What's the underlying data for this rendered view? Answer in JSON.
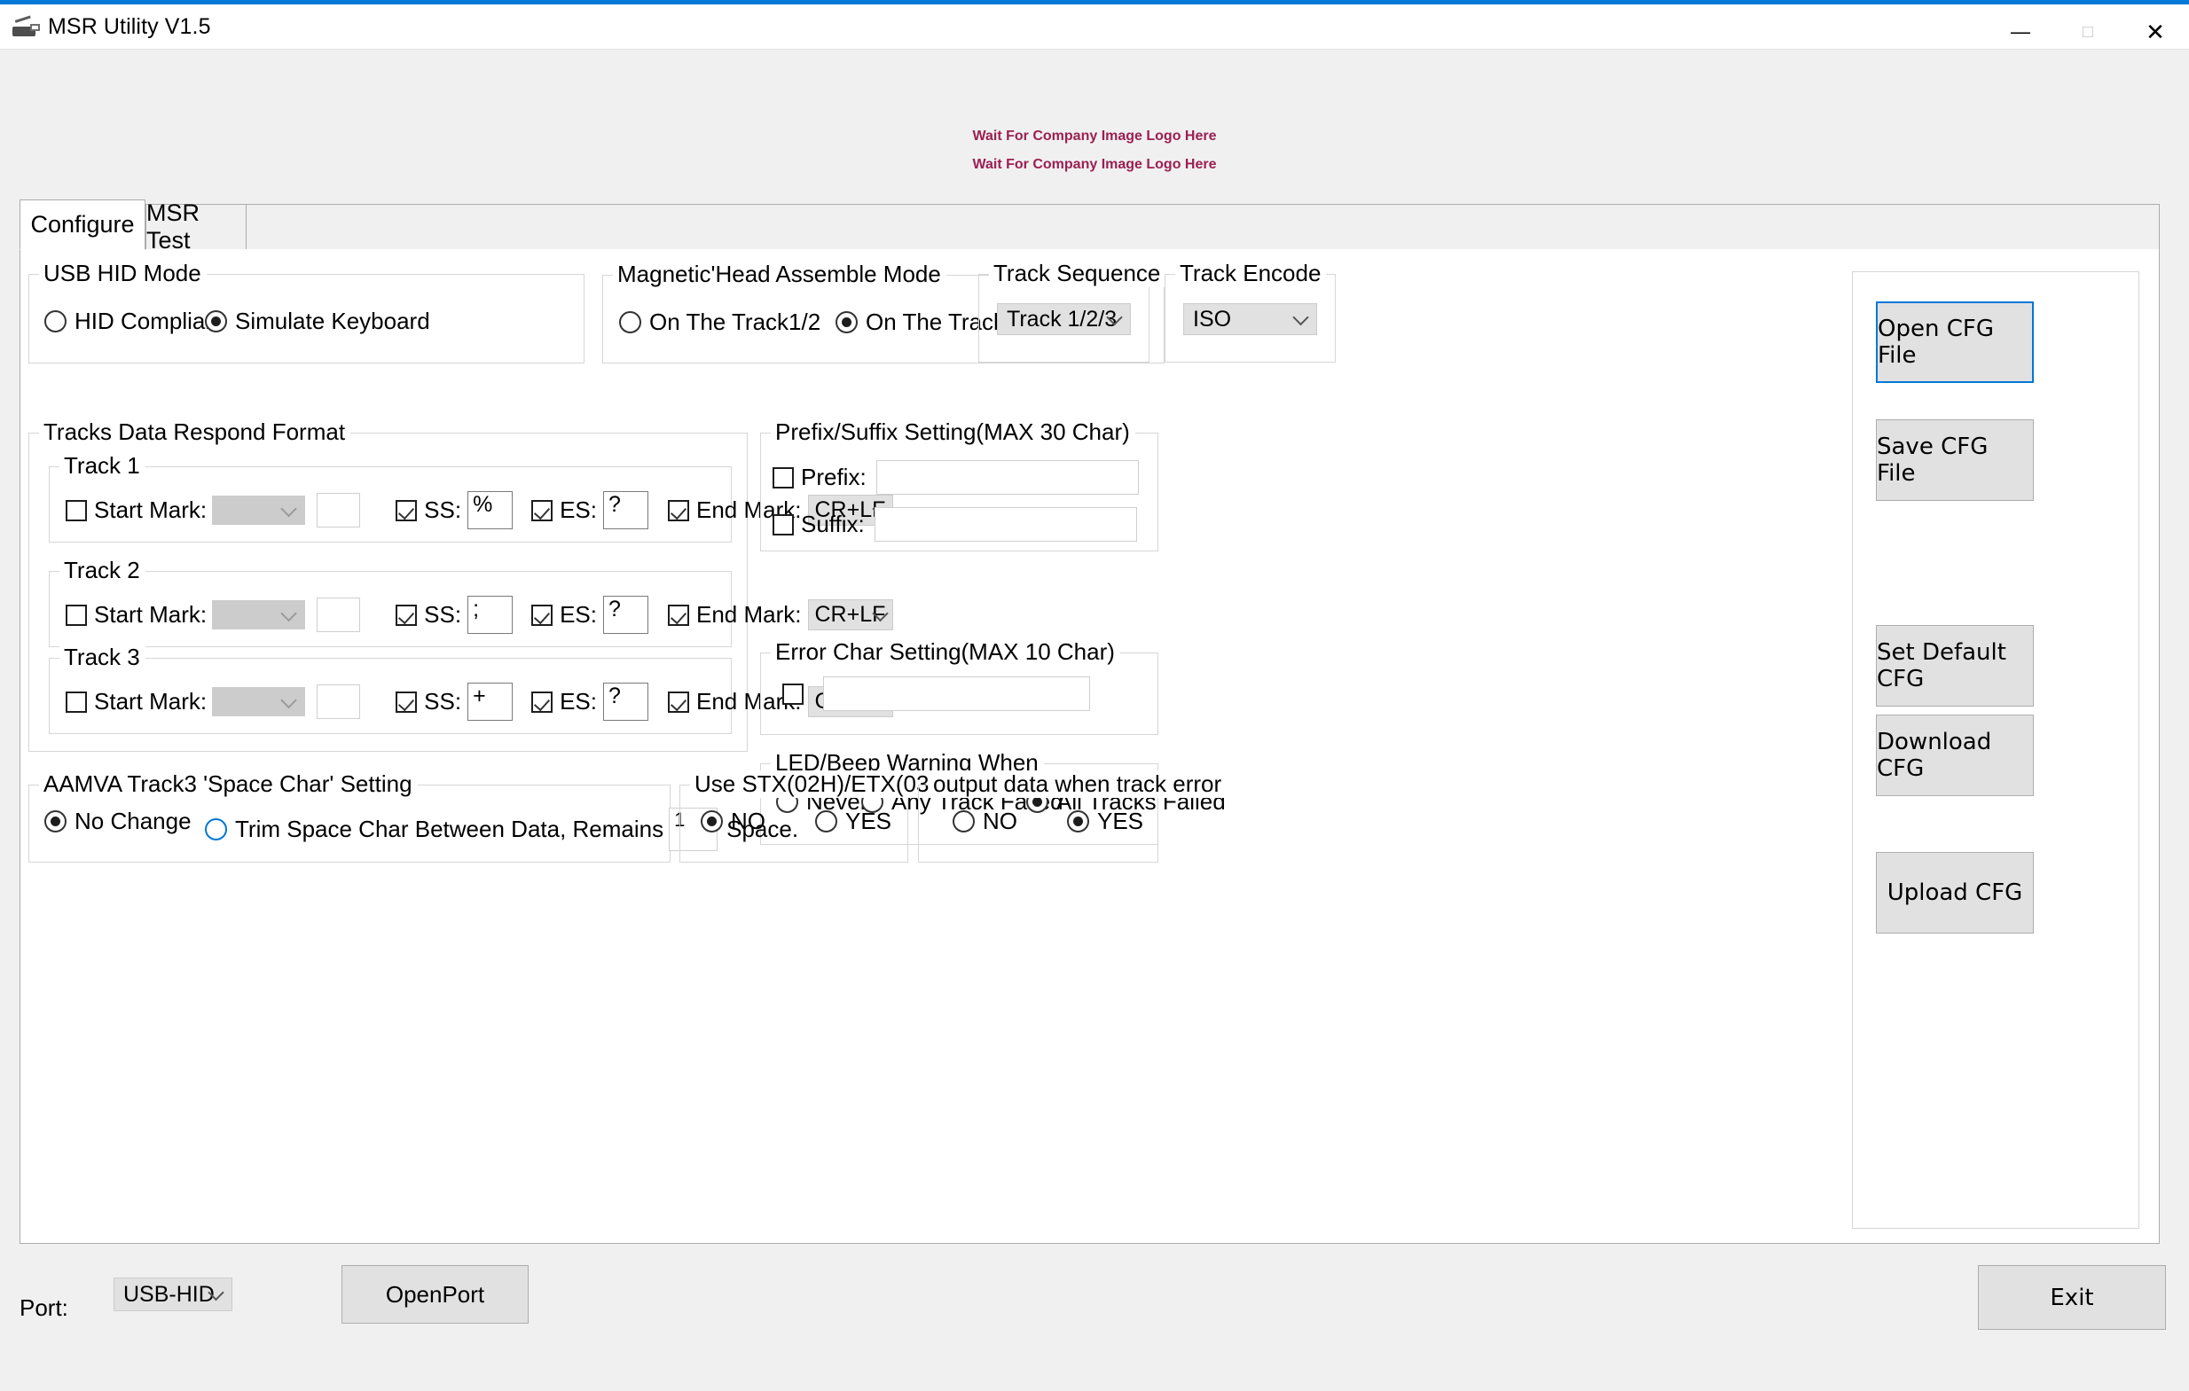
{
  "window": {
    "title": "MSR Utility V1.5",
    "icon": "magnetic-card-reader-icon",
    "minimize": "—",
    "maximize": "□",
    "close": "✕"
  },
  "logo": {
    "line1": "Wait For Company Image Logo Here",
    "line2": "Wait For Company Image Logo Here",
    "color": "#9c1f52"
  },
  "tabs": [
    {
      "label": "Configure",
      "active": true
    },
    {
      "label": "MSR Test",
      "active": false
    }
  ],
  "usb_hid_mode": {
    "title": "USB HID Mode",
    "options": [
      {
        "label": "HID Compliant",
        "selected": false
      },
      {
        "label": "Simulate Keyboard",
        "selected": true
      }
    ]
  },
  "magnetic_head": {
    "title": "Magnetic'Head Assemble Mode",
    "options": [
      {
        "label": "On The Track1/2",
        "selected": false
      },
      {
        "label": "On The Track2/3",
        "selected": true
      }
    ]
  },
  "track_sequence": {
    "title": "Track Sequence",
    "value": "Track 1/2/3"
  },
  "track_encode": {
    "title": "Track Encode",
    "value": "ISO"
  },
  "tracks_format": {
    "title": "Tracks Data Respond Format",
    "labels": {
      "start_mark": "Start Mark:",
      "ss": "SS:",
      "es": "ES:",
      "end_mark": "End Mark:"
    },
    "tracks": [
      {
        "title": "Track 1",
        "start_mark_checked": false,
        "start_mark_value": "",
        "start_mark_extra": "",
        "ss_checked": true,
        "ss_value": "%",
        "es_checked": true,
        "es_value": "?",
        "end_mark_checked": true,
        "end_mark_value": "CR+LF"
      },
      {
        "title": "Track 2",
        "start_mark_checked": false,
        "start_mark_value": "",
        "start_mark_extra": "",
        "ss_checked": true,
        "ss_value": ";",
        "es_checked": true,
        "es_value": "?",
        "end_mark_checked": true,
        "end_mark_value": "CR+LF"
      },
      {
        "title": "Track 3",
        "start_mark_checked": false,
        "start_mark_value": "",
        "start_mark_extra": "",
        "ss_checked": true,
        "ss_value": "+",
        "es_checked": true,
        "es_value": "?",
        "end_mark_checked": true,
        "end_mark_value": "CR+LF"
      }
    ]
  },
  "prefix_suffix": {
    "title": "Prefix/Suffix Setting(MAX 30 Char)",
    "prefix_label": "Prefix:",
    "prefix_checked": false,
    "prefix_value": "",
    "suffix_label": "Suffix:",
    "suffix_checked": false,
    "suffix_value": ""
  },
  "error_char": {
    "title": "Error Char Setting(MAX 10 Char)",
    "checked": false,
    "value": ""
  },
  "led_beep": {
    "title": "LED/Beep Warning When",
    "options": [
      {
        "label": "Never",
        "selected": false
      },
      {
        "label": "Any Track Failed",
        "selected": false
      },
      {
        "label": "All Tracks Failed",
        "selected": true
      }
    ]
  },
  "aamva": {
    "title": "AAMVA Track3 'Space Char' Setting",
    "options": [
      {
        "label": "No Change",
        "selected": true,
        "highlight": false
      },
      {
        "label": "Trim Space Char Between Data, Remains",
        "selected": false,
        "highlight": true
      }
    ],
    "remains_value": "1",
    "space_suffix": "Space."
  },
  "stx_etx": {
    "title": "Use STX(02H)/ETX(03H) ?",
    "options": [
      {
        "label": "NO",
        "selected": true
      },
      {
        "label": "YES",
        "selected": false
      }
    ]
  },
  "track_error_output": {
    "title": "output data when track error",
    "options": [
      {
        "label": "NO",
        "selected": false
      },
      {
        "label": "YES",
        "selected": true
      }
    ]
  },
  "side_buttons": [
    {
      "label": "Open CFG File",
      "focused": true
    },
    {
      "label": "Save CFG File",
      "focused": false
    },
    {
      "label": "Set Default CFG",
      "focused": false
    },
    {
      "label": "Download CFG",
      "focused": false
    },
    {
      "label": "Upload CFG",
      "focused": false
    }
  ],
  "bottom": {
    "port_label": "Port:",
    "port_value": "USB-HID",
    "open_port_label": "OpenPort",
    "exit_label": "Exit"
  }
}
